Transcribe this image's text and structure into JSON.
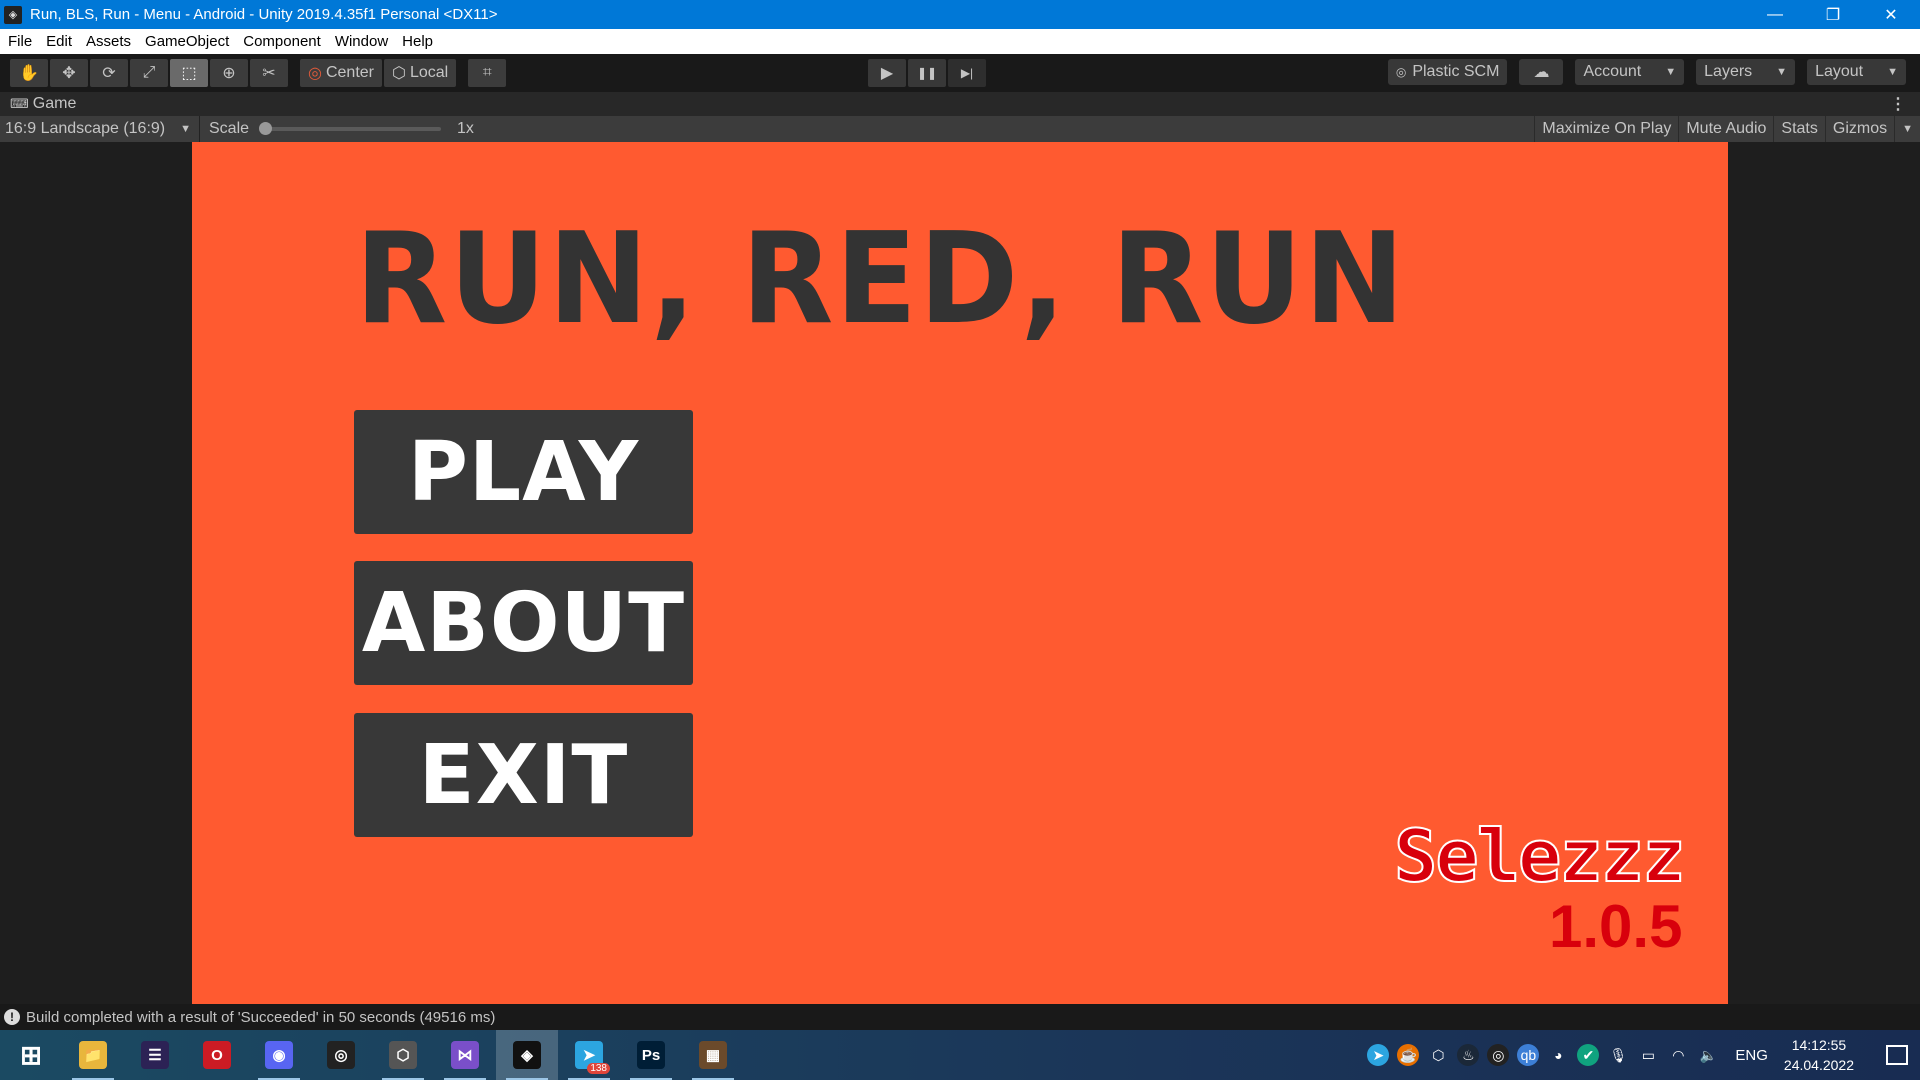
{
  "window": {
    "title": "Run, BLS, Run - Menu - Android - Unity 2019.4.35f1 Personal <DX11>",
    "controls": {
      "minimize": "—",
      "restore": "❐",
      "close": "✕"
    }
  },
  "menu": [
    "File",
    "Edit",
    "Assets",
    "GameObject",
    "Component",
    "Window",
    "Help"
  ],
  "toolbar": {
    "tools": [
      {
        "name": "hand-tool",
        "icon": "✋"
      },
      {
        "name": "move-tool",
        "icon": "✥"
      },
      {
        "name": "rotate-tool",
        "icon": "⟳"
      },
      {
        "name": "scale-tool",
        "icon": "⤢"
      },
      {
        "name": "rect-tool",
        "icon": "⬚",
        "active": true
      },
      {
        "name": "transform-tool",
        "icon": "⊕"
      },
      {
        "name": "custom-tool",
        "icon": "✂"
      }
    ],
    "pivot_label": "Center",
    "space_label": "Local",
    "snap_icon": "⌗",
    "play_icon": "▶",
    "pause_icon": "❚❚",
    "step_icon": "▶|",
    "plastic_label": "Plastic SCM",
    "cloud_icon": "☁",
    "account_label": "Account",
    "layers_label": "Layers",
    "layout_label": "Layout"
  },
  "game_tab": {
    "label": "Game",
    "icon": "🎮",
    "aspect": "16:9 Landscape (16:9)",
    "scale_label": "Scale",
    "scale_value": "1x",
    "scale_fraction": 0.0,
    "options": [
      "Maximize On Play",
      "Mute Audio",
      "Stats",
      "Gizmos"
    ]
  },
  "game": {
    "title": "RUN, RED, RUN",
    "buttons": [
      "PLAY",
      "ABOUT",
      "EXIT"
    ],
    "brand": "Selezzz",
    "version": "1.0.5",
    "colors": {
      "background": "#ff5a30",
      "button": "#383838",
      "brand": "#d8000c"
    }
  },
  "status": {
    "message": "Build completed with a result of 'Succeeded' in 50 seconds (49516 ms)"
  },
  "taskbar": {
    "apps": [
      {
        "name": "start",
        "glyph": "⊞",
        "bg": "transparent"
      },
      {
        "name": "file-explorer",
        "glyph": "📁",
        "bg": "#e8b63c",
        "open": true
      },
      {
        "name": "eclipse",
        "glyph": "☰",
        "bg": "#2c2255"
      },
      {
        "name": "opera",
        "glyph": "O",
        "bg": "#cc1b24"
      },
      {
        "name": "discord-chrome",
        "glyph": "◉",
        "bg": "#5865f2",
        "open": true
      },
      {
        "name": "obs",
        "glyph": "◎",
        "bg": "#222"
      },
      {
        "name": "unity-hub",
        "glyph": "⬡",
        "bg": "#555",
        "open": true
      },
      {
        "name": "visual-studio",
        "glyph": "⋈",
        "bg": "#7a4fc9",
        "open": true
      },
      {
        "name": "unity",
        "glyph": "◈",
        "bg": "#111",
        "active": true,
        "open": true
      },
      {
        "name": "telegram",
        "glyph": "➤",
        "bg": "#2ca5e0",
        "badge": "138",
        "open": true
      },
      {
        "name": "photoshop",
        "glyph": "Ps",
        "bg": "#001e36",
        "open": true
      },
      {
        "name": "minecraft",
        "glyph": "▦",
        "bg": "#6b4a2b",
        "open": true
      }
    ],
    "tray": [
      {
        "name": "telegram-tray",
        "glyph": "➤",
        "bg": "#2ca5e0"
      },
      {
        "name": "java",
        "glyph": "☕",
        "bg": "#e76f00"
      },
      {
        "name": "unity-tray",
        "glyph": "⬡",
        "bg": "transparent"
      },
      {
        "name": "steam",
        "glyph": "♨",
        "bg": "#1b2838"
      },
      {
        "name": "obs-tray",
        "glyph": "◎",
        "bg": "#222"
      },
      {
        "name": "qbittorrent",
        "glyph": "qb",
        "bg": "#3d7fd6"
      },
      {
        "name": "discord-tray",
        "glyph": "◕",
        "bg": "transparent"
      },
      {
        "name": "security",
        "glyph": "✔",
        "bg": "#10a37f"
      },
      {
        "name": "microphone",
        "glyph": "🎙",
        "bg": "transparent"
      },
      {
        "name": "battery",
        "glyph": "▭",
        "bg": "transparent"
      },
      {
        "name": "wifi",
        "glyph": "◠",
        "bg": "transparent"
      },
      {
        "name": "volume",
        "glyph": "🔈",
        "bg": "transparent"
      }
    ],
    "language": "ENG",
    "time": "14:12:55",
    "date": "24.04.2022"
  }
}
